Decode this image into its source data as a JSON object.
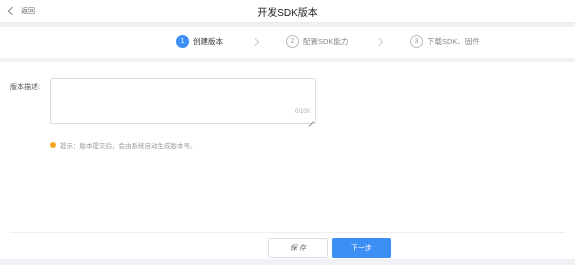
{
  "header": {
    "back_label": "返回",
    "title": "开发SDK版本"
  },
  "steps": [
    {
      "num": "1",
      "label": "创建版本"
    },
    {
      "num": "2",
      "label": "配置SDK能力"
    },
    {
      "num": "3",
      "label": "下载SDK、固件"
    }
  ],
  "form": {
    "label": "版本描述:",
    "counter": "0/100",
    "tip": "提示：版本提交后，会由系统自动生成版本号。"
  },
  "buttons": {
    "save": "保 存",
    "next": "下一步"
  },
  "colors": {
    "accent": "#3b8ff5",
    "tip": "#f5a623"
  }
}
